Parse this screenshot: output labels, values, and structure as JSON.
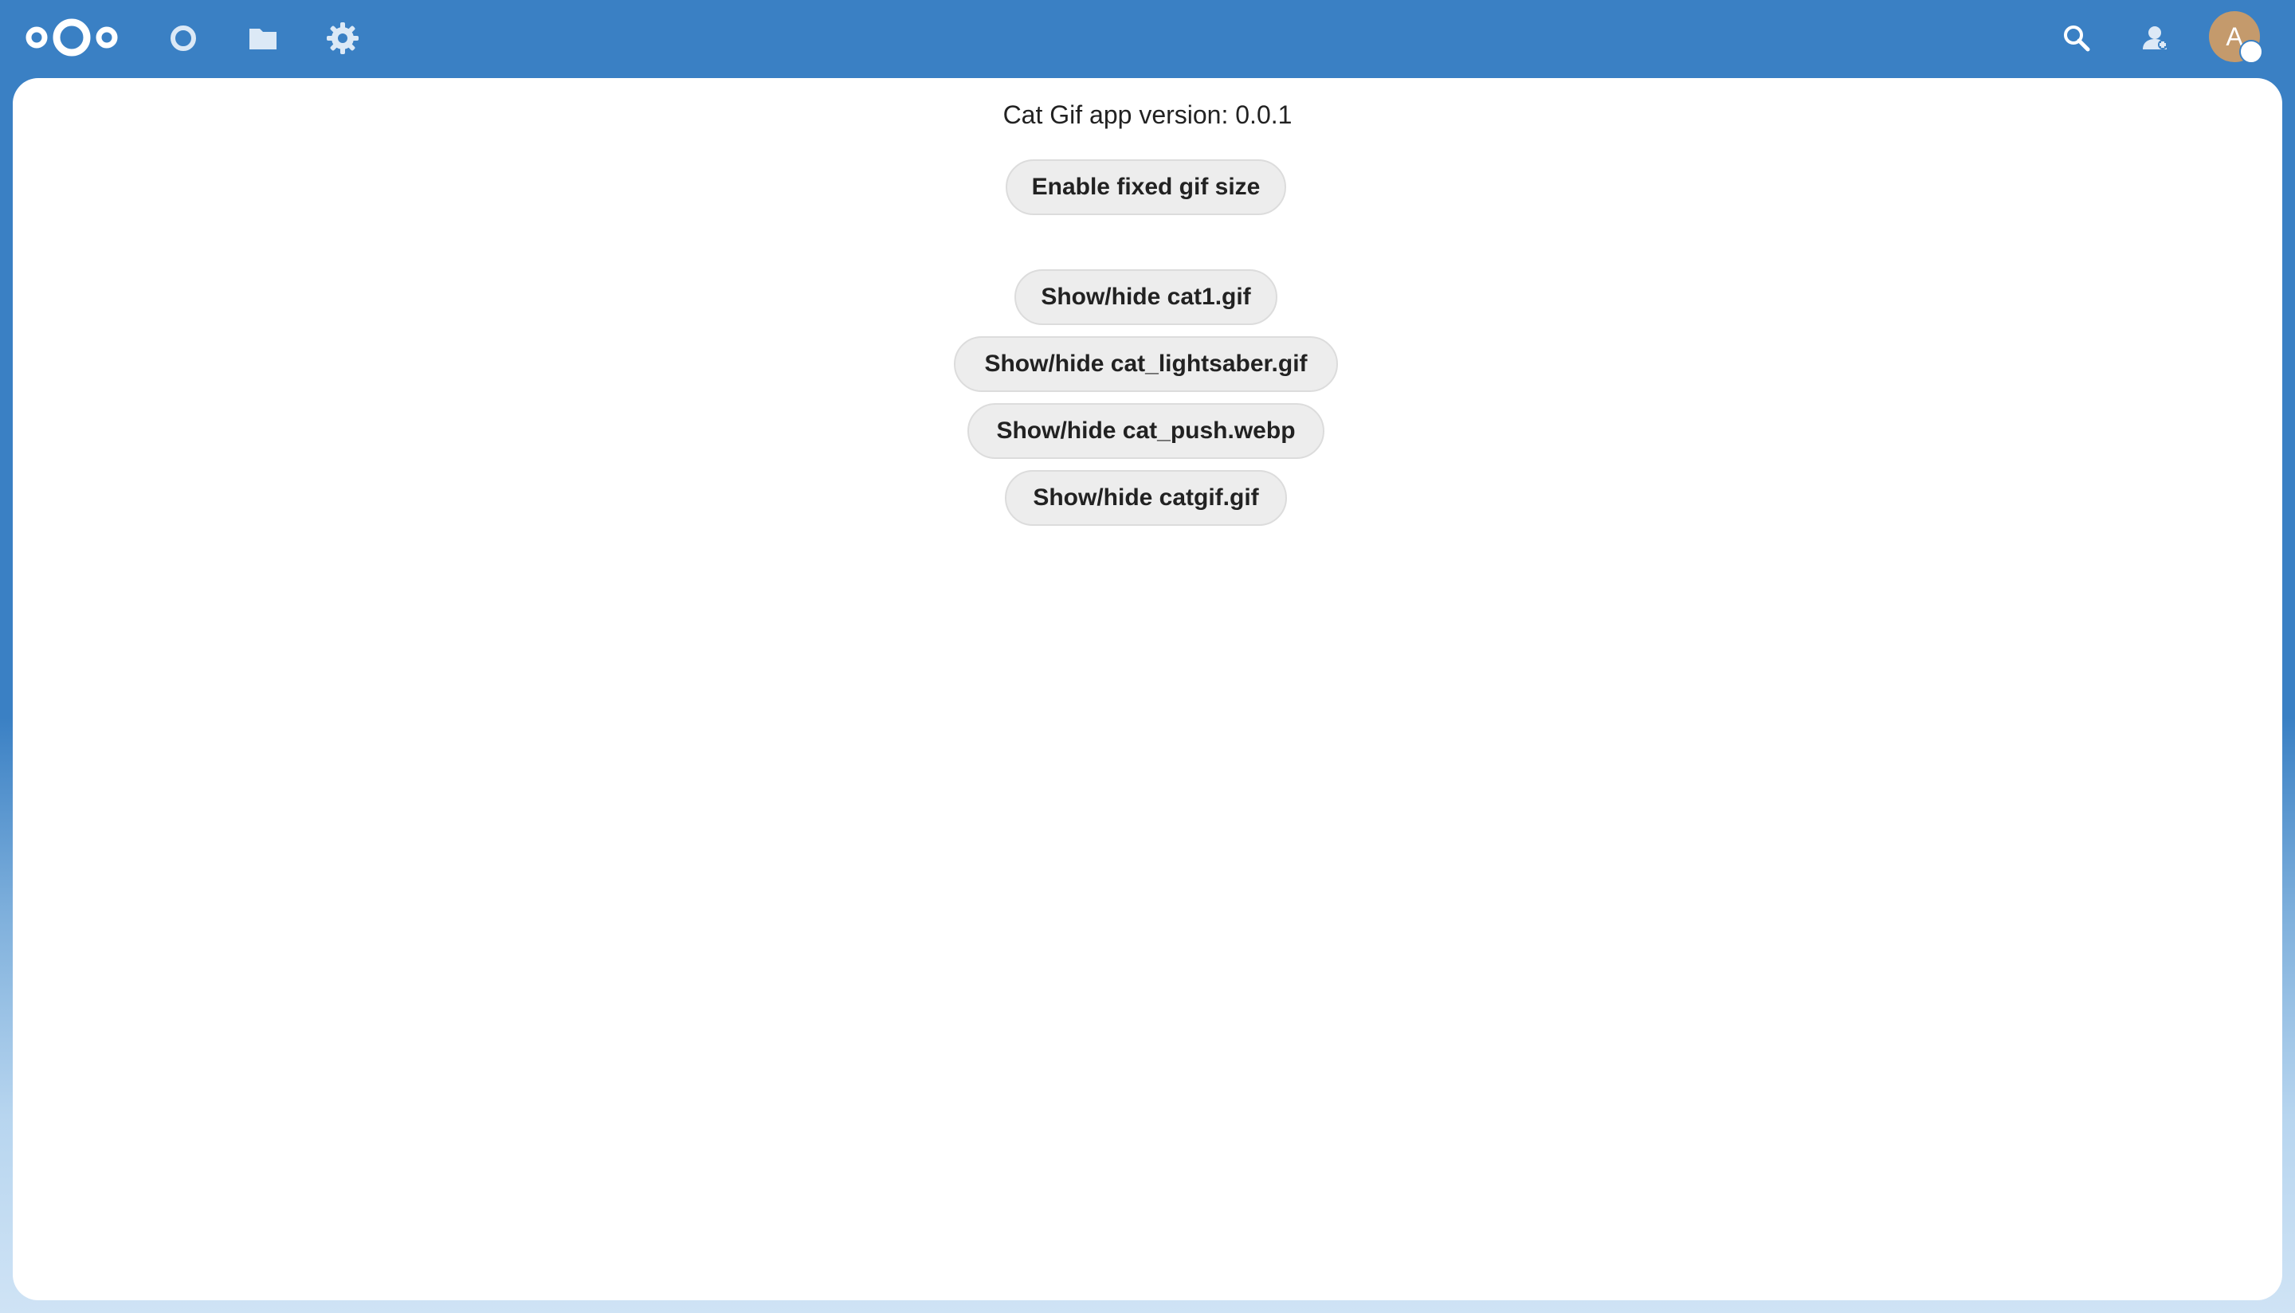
{
  "header": {
    "logo_icon": "nextcloud-logo",
    "nav": [
      {
        "icon": "dashboard-circle-icon"
      },
      {
        "icon": "files-folder-icon"
      },
      {
        "icon": "settings-gear-icon"
      }
    ],
    "search_icon": "search-icon",
    "contacts_icon": "contacts-icon",
    "avatar_initial": "A",
    "colors": {
      "header_bg": "#3a80c4",
      "avatar_bg": "#c49a6c"
    }
  },
  "main": {
    "version_text": "Cat Gif app version: 0.0.1",
    "fixed_size_button": "Enable fixed gif size",
    "gif_buttons": [
      {
        "label": "Show/hide cat1.gif"
      },
      {
        "label": "Show/hide cat_lightsaber.gif"
      },
      {
        "label": "Show/hide cat_push.webp"
      },
      {
        "label": "Show/hide catgif.gif"
      }
    ]
  }
}
